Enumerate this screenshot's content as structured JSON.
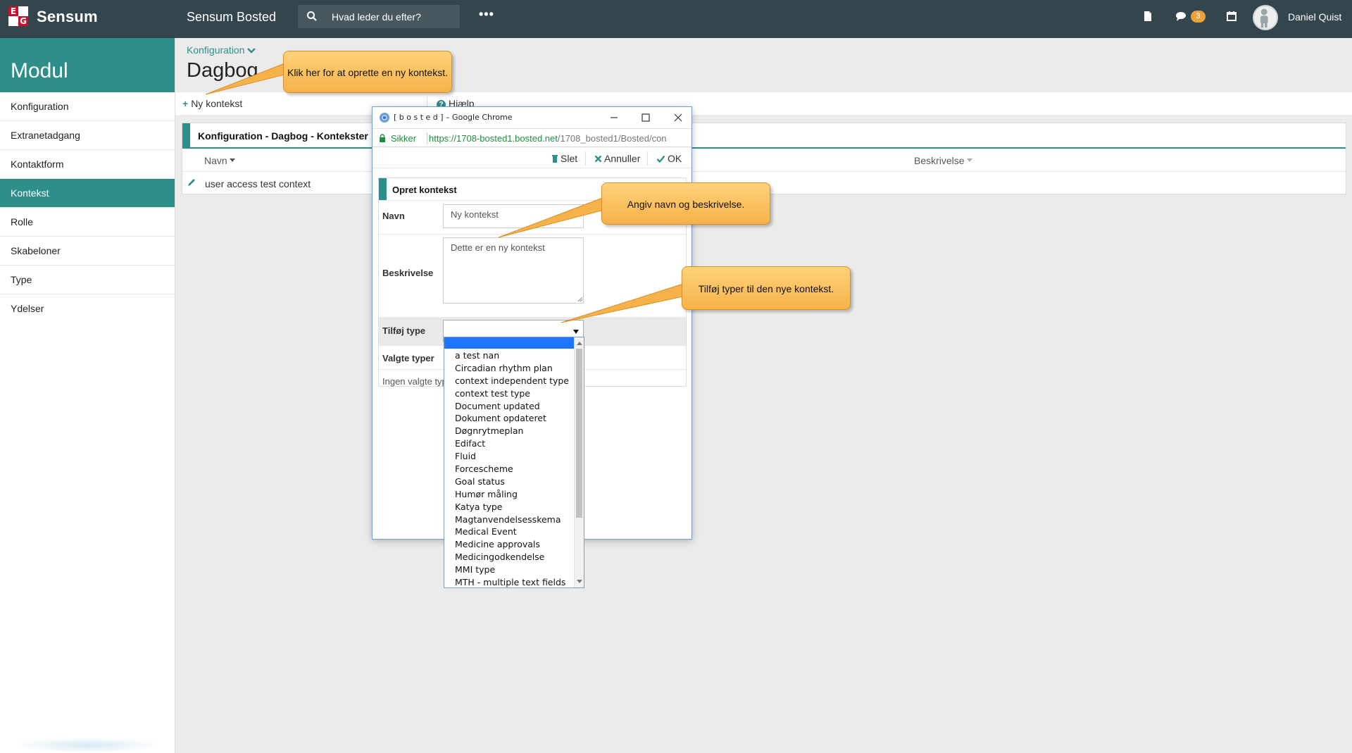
{
  "topbar": {
    "brand": "Sensum",
    "app_name": "Sensum Bosted",
    "search_placeholder": "Hvad leder du efter?",
    "more_label": "•••",
    "messages_count": "3",
    "user_name": "Daniel Quist"
  },
  "sidebar": {
    "title": "Modul",
    "items": [
      {
        "label": "Konfiguration"
      },
      {
        "label": "Extranetadgang"
      },
      {
        "label": "Kontaktform"
      },
      {
        "label": "Kontekst",
        "active": true
      },
      {
        "label": "Rolle"
      },
      {
        "label": "Skabeloner"
      },
      {
        "label": "Type"
      },
      {
        "label": "Ydelser"
      }
    ]
  },
  "main": {
    "breadcrumb": "Konfiguration",
    "title": "Dagbog",
    "toolbar": {
      "new_label": "Ny kontekst",
      "help_label": "Hjælp"
    },
    "panel": {
      "title": "Konfiguration - Dagbog - Kontekster",
      "columns": {
        "name": "Navn",
        "description": "Beskrivelse"
      },
      "rows": [
        {
          "name": "user access test context"
        }
      ]
    }
  },
  "popup": {
    "window_title": "[ b o s t e d ] – Google Chrome",
    "secure_label": "Sikker",
    "url_host": "https://1708-bosted1.bosted.net",
    "url_path": "/1708_bosted1/Bosted/con",
    "toolbar": {
      "delete_label": "Slet",
      "cancel_label": "Annuller",
      "ok_label": "OK"
    },
    "form": {
      "title": "Opret kontekst",
      "name_label": "Navn",
      "name_value": "Ny kontekst",
      "description_label": "Beskrivelse",
      "description_value": "Dette er en ny kontekst",
      "add_type_label": "Tilføj type",
      "selected_types_label": "Valgte typer",
      "no_selected_types": "Ingen valgte typer"
    }
  },
  "dropdown": {
    "options": [
      "a test nan",
      "Circadian rhythm plan",
      "context independent type",
      "context test type",
      "Document updated",
      "Dokument opdateret",
      "Døgnrytmeplan",
      "Edifact",
      "Fluid",
      "Forcescheme",
      "Goal status",
      "Humør måling",
      "Katya type",
      "Magtanvendelsesskema",
      "Medical Event",
      "Medicine approvals",
      "Medicingodkendelse",
      "MMI type",
      "MTH - multiple text fields"
    ]
  },
  "callouts": {
    "new_context": "Klik her for at oprette en ny kontekst.",
    "name_description": "Angiv navn og beskrivelse.",
    "add_types": "Tilføj typer til den nye kontekst."
  },
  "colors": {
    "accent": "#2e8f8a",
    "topbar": "#34464d",
    "callout": "#f6b24a",
    "badge": "#e8a33d"
  },
  "icons": [
    "eg-logo",
    "search-icon",
    "document-icon",
    "chat-icon",
    "calendar-icon",
    "avatar",
    "pencil-icon",
    "chrome-icon",
    "lock-icon",
    "trash-icon",
    "close-icon",
    "check-icon"
  ]
}
